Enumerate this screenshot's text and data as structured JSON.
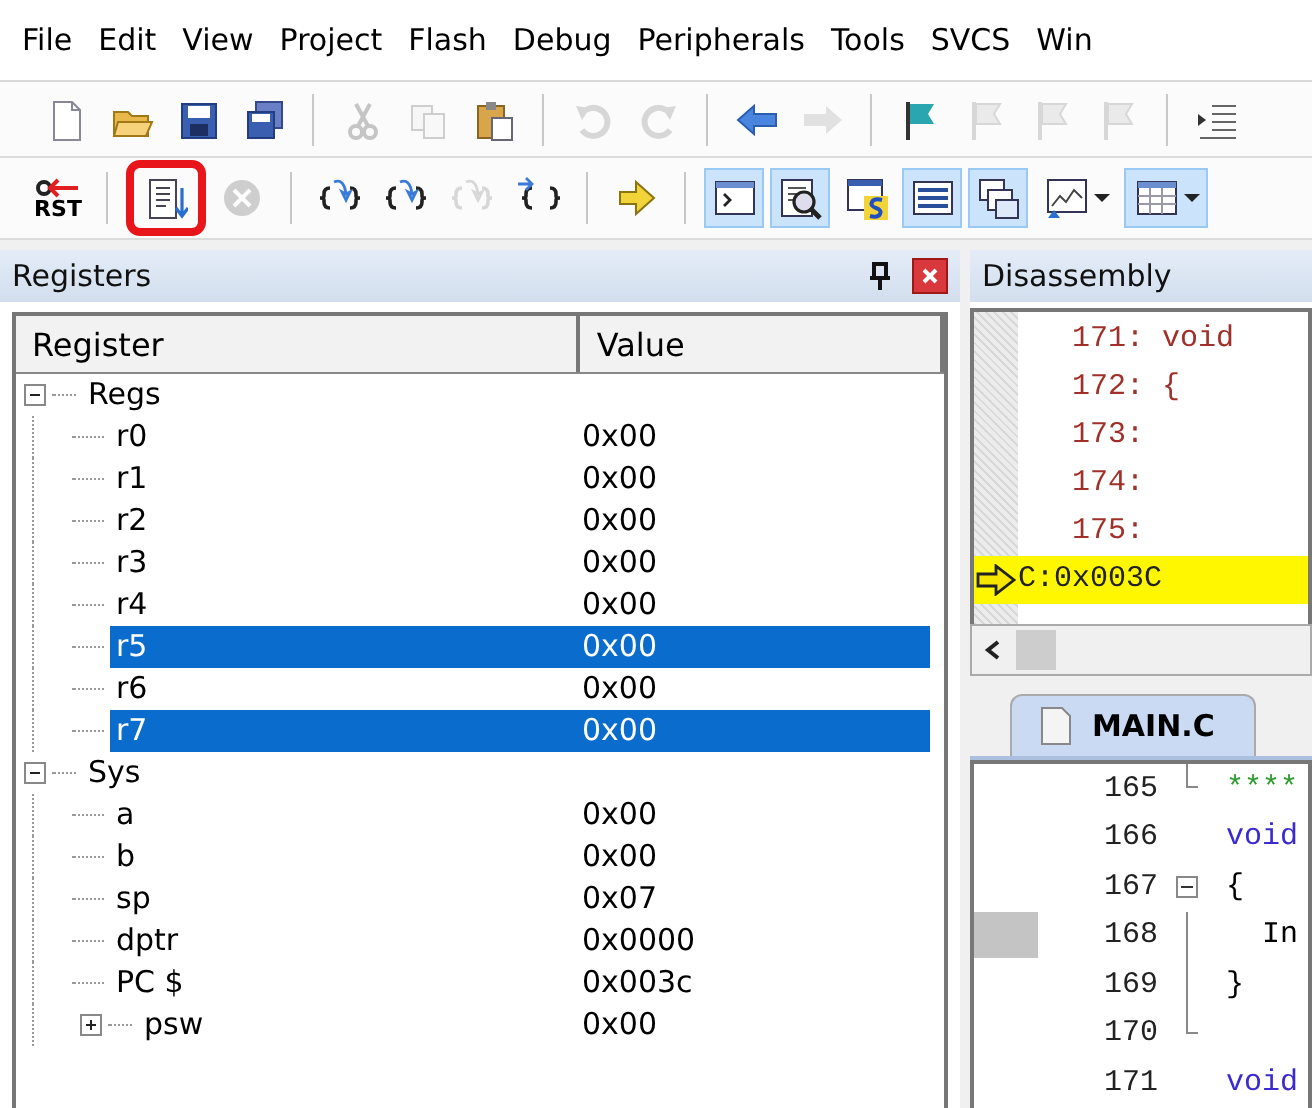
{
  "menu": [
    "File",
    "Edit",
    "View",
    "Project",
    "Flash",
    "Debug",
    "Peripherals",
    "Tools",
    "SVCS",
    "Win"
  ],
  "toolbar_file": [
    {
      "kind": "new",
      "disabled": false
    },
    {
      "kind": "open",
      "disabled": false
    },
    {
      "kind": "save",
      "disabled": false
    },
    {
      "kind": "saveall",
      "disabled": false
    },
    {
      "kind": "separator"
    },
    {
      "kind": "cut",
      "disabled": true
    },
    {
      "kind": "copy",
      "disabled": true
    },
    {
      "kind": "paste",
      "disabled": false
    },
    {
      "kind": "separator"
    },
    {
      "kind": "undo",
      "disabled": true
    },
    {
      "kind": "redo",
      "disabled": true
    },
    {
      "kind": "separator"
    },
    {
      "kind": "back",
      "disabled": false
    },
    {
      "kind": "forward",
      "disabled": true
    },
    {
      "kind": "separator"
    },
    {
      "kind": "flag",
      "disabled": false
    },
    {
      "kind": "flagprev",
      "disabled": true
    },
    {
      "kind": "flagnext",
      "disabled": true
    },
    {
      "kind": "flagclear",
      "disabled": true
    },
    {
      "kind": "separator"
    },
    {
      "kind": "indent",
      "disabled": false
    }
  ],
  "toolbar_debug": [
    {
      "kind": "reset",
      "label": "RST",
      "disabled": false,
      "pressed": false,
      "highlighted": false
    },
    {
      "kind": "separator"
    },
    {
      "kind": "trace",
      "disabled": false,
      "pressed": false,
      "highlighted": true
    },
    {
      "kind": "stop",
      "disabled": true,
      "pressed": false,
      "highlighted": false
    },
    {
      "kind": "separator"
    },
    {
      "kind": "stepin",
      "disabled": false,
      "pressed": false,
      "highlighted": false
    },
    {
      "kind": "stepover",
      "disabled": false,
      "pressed": false,
      "highlighted": false
    },
    {
      "kind": "stepout",
      "disabled": true,
      "pressed": false,
      "highlighted": false
    },
    {
      "kind": "runcursor",
      "disabled": false,
      "pressed": false,
      "highlighted": false
    },
    {
      "kind": "separator"
    },
    {
      "kind": "shownext",
      "disabled": false,
      "pressed": false,
      "highlighted": false
    },
    {
      "kind": "separator"
    },
    {
      "kind": "command",
      "disabled": false,
      "pressed": true,
      "highlighted": false
    },
    {
      "kind": "disasm",
      "disabled": false,
      "pressed": true,
      "highlighted": false
    },
    {
      "kind": "symbols",
      "disabled": false,
      "pressed": false,
      "highlighted": false
    },
    {
      "kind": "registers",
      "disabled": false,
      "pressed": true,
      "highlighted": false
    },
    {
      "kind": "callstack",
      "disabled": false,
      "pressed": true,
      "highlighted": false
    },
    {
      "kind": "analysis",
      "disabled": false,
      "pressed": false,
      "highlighted": false,
      "dropdown": true
    },
    {
      "kind": "memory",
      "disabled": false,
      "pressed": true,
      "highlighted": false,
      "dropdown": true
    }
  ],
  "registers": {
    "title": "Registers",
    "columns": [
      "Register",
      "Value"
    ],
    "tree": [
      {
        "name": "Regs",
        "expanded": true,
        "selected": false,
        "children": [
          {
            "name": "r0",
            "value": "0x00",
            "selected": false
          },
          {
            "name": "r1",
            "value": "0x00",
            "selected": false
          },
          {
            "name": "r2",
            "value": "0x00",
            "selected": false
          },
          {
            "name": "r3",
            "value": "0x00",
            "selected": false
          },
          {
            "name": "r4",
            "value": "0x00",
            "selected": false
          },
          {
            "name": "r5",
            "value": "0x00",
            "selected": true
          },
          {
            "name": "r6",
            "value": "0x00",
            "selected": false
          },
          {
            "name": "r7",
            "value": "0x00",
            "selected": true
          }
        ]
      },
      {
        "name": "Sys",
        "expanded": true,
        "selected": false,
        "children": [
          {
            "name": "a",
            "value": "0x00",
            "selected": false
          },
          {
            "name": "b",
            "value": "0x00",
            "selected": false
          },
          {
            "name": "sp",
            "value": "0x07",
            "selected": false
          },
          {
            "name": "dptr",
            "value": "0x0000",
            "selected": false
          },
          {
            "name": "PC  $",
            "value": "0x003c",
            "selected": false
          },
          {
            "name": "psw",
            "value": "0x00",
            "selected": false,
            "expanded": false
          }
        ]
      }
    ]
  },
  "disassembly": {
    "title": "Disassembly",
    "lines": [
      {
        "text": "   171: void",
        "current": false
      },
      {
        "text": "   172: {",
        "current": false
      },
      {
        "text": "   173:",
        "current": false
      },
      {
        "text": "   174:",
        "current": false
      },
      {
        "text": "   175:",
        "current": false
      },
      {
        "text": "C:0x003C",
        "current": true
      }
    ]
  },
  "editor": {
    "tabs": [
      {
        "label": "MAIN.C",
        "selected": true
      }
    ],
    "lines": [
      {
        "number": "165",
        "text": "****",
        "kind": "comment",
        "marked": false,
        "fold_end": true
      },
      {
        "number": "166",
        "text": "void",
        "kind": "keyword",
        "marked": false
      },
      {
        "number": "167",
        "text": "{",
        "kind": "code",
        "marked": false,
        "fold_start": true
      },
      {
        "number": "168",
        "text": "  In",
        "kind": "code",
        "marked": true
      },
      {
        "number": "169",
        "text": "}",
        "kind": "code",
        "marked": false
      },
      {
        "number": "170",
        "marked": false,
        "fold_end": true
      },
      {
        "number": "171",
        "text": "void",
        "kind": "keyword",
        "marked": false
      }
    ]
  }
}
